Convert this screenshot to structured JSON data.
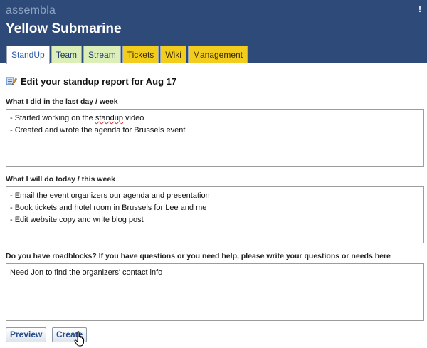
{
  "app": {
    "brand": "assembla",
    "project": "Yellow Submarine",
    "corner_mark": "!"
  },
  "tabs": [
    {
      "label": "StandUp",
      "style": "active"
    },
    {
      "label": "Team",
      "style": "green"
    },
    {
      "label": "Stream",
      "style": "green"
    },
    {
      "label": "Tickets",
      "style": "yellow"
    },
    {
      "label": "Wiki",
      "style": "yellow"
    },
    {
      "label": "Management",
      "style": "yellow"
    }
  ],
  "form": {
    "title": "Edit your standup report for Aug 17",
    "done": {
      "label": "What I did in the last day / week",
      "lines": [
        "- Started working on the ",
        "standup",
        " video",
        "- Created and wrote the agenda for Brussels event"
      ]
    },
    "todo": {
      "label": "What I will do today / this week",
      "lines": [
        "- Email the event organizers our agenda and presentation",
        "- Book tickets and hotel room in Brussels for Lee and me",
        "- Edit website copy and write blog post"
      ]
    },
    "roadblocks": {
      "label": "Do you have roadblocks? If you have questions or you need help, please write your questions or needs here",
      "lines": [
        "Need Jon to find the organizers' contact info"
      ]
    },
    "buttons": {
      "preview": "Preview",
      "create": "Create"
    }
  },
  "colors": {
    "header_bg": "#2d4a78",
    "tab_green": "#dcefb8",
    "tab_yellow": "#f3cd1e"
  }
}
